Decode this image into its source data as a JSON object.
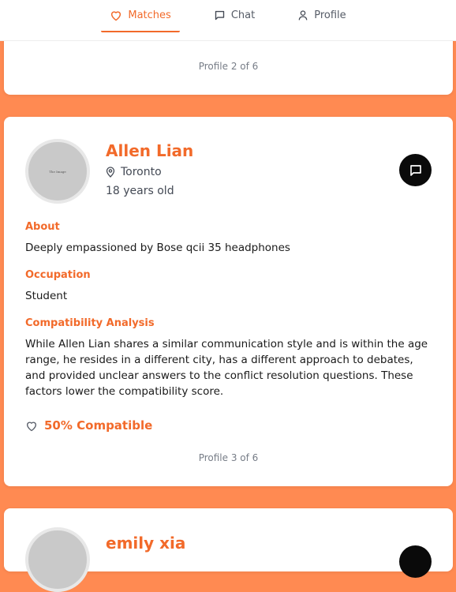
{
  "nav": {
    "tabs": [
      {
        "label": "Matches",
        "icon": "heart-icon",
        "active": true
      },
      {
        "label": "Chat",
        "icon": "chat-icon",
        "active": false
      },
      {
        "label": "Profile",
        "icon": "user-icon",
        "active": false
      }
    ]
  },
  "colors": {
    "accent": "#f26a2a",
    "page_bg": "#ff8a52",
    "card_bg": "#ffffff"
  },
  "prev_card": {
    "counter": "Profile 2 of 6"
  },
  "profile": {
    "name": "Allen Lian",
    "avatar_alt": "The Image",
    "location": "Toronto",
    "age": "18 years old",
    "about_heading": "About",
    "about": "Deeply empassioned by Bose qcii 35 headphones",
    "occupation_heading": "Occupation",
    "occupation": "Student",
    "analysis_heading": "Compatibility Analysis",
    "analysis": "While Allen Lian shares a similar communication style and is within the age range, he resides in a different city, has a different approach to debates, and provided unclear answers to the conflict resolution questions. These factors lower the compatibility score.",
    "compatibility": "50% Compatible",
    "counter": "Profile 3 of 6"
  },
  "next_card": {
    "name": "emily xia"
  }
}
